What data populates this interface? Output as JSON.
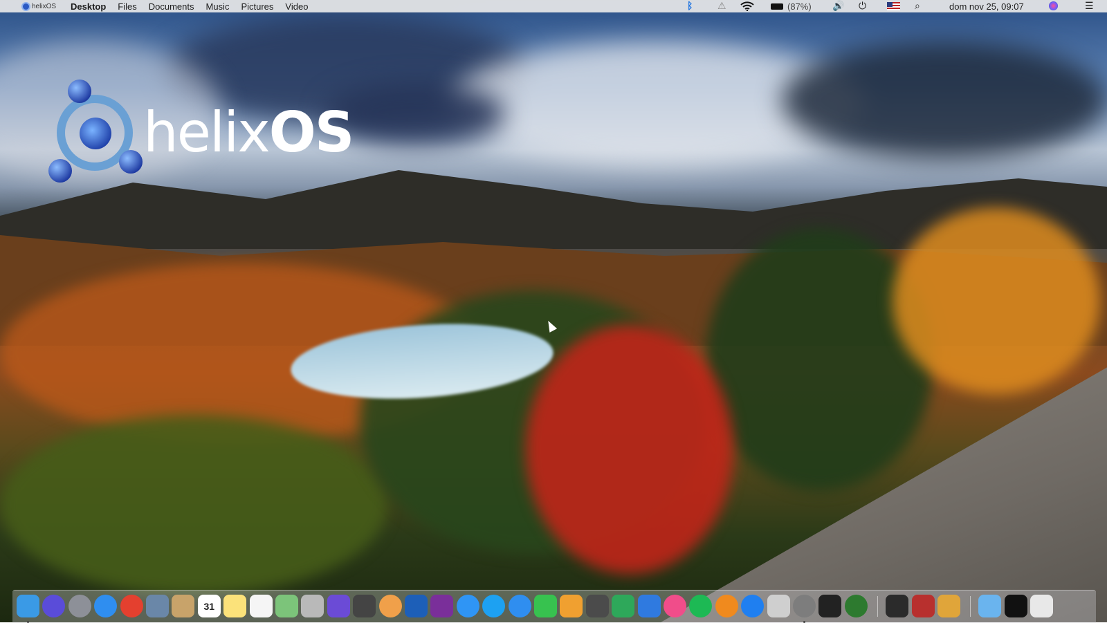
{
  "menubar": {
    "logo_text": "helixOS",
    "items": [
      "Desktop",
      "Files",
      "Documents",
      "Music",
      "Pictures",
      "Video"
    ],
    "battery": "(87%)",
    "clock": "dom nov 25, 09:07",
    "status_icons": [
      "bluetooth-icon",
      "warning-icon",
      "wifi-icon",
      "battery-icon",
      "speaker-icon",
      "power-icon",
      "flag-us-icon",
      "search-icon",
      "siri-icon",
      "menu-list-icon"
    ]
  },
  "desktop": {
    "logo": {
      "word_light": "helix",
      "word_bold": "OS"
    }
  },
  "dock": {
    "apps": [
      {
        "name": "finder-icon",
        "color": "#3a9ae6"
      },
      {
        "name": "siri-icon",
        "color": "#5a4cd9"
      },
      {
        "name": "launchpad-icon",
        "color": "#8d9098"
      },
      {
        "name": "safari-icon",
        "color": "#2f8ef0"
      },
      {
        "name": "chrome-icon",
        "color": "#e4402f"
      },
      {
        "name": "preview-icon",
        "color": "#6a87a8"
      },
      {
        "name": "contacts-icon",
        "color": "#c8a36a"
      },
      {
        "name": "calendar-icon",
        "color": "#ffffff",
        "text": "31"
      },
      {
        "name": "notes-icon",
        "color": "#fbe27a"
      },
      {
        "name": "reminders-icon",
        "color": "#f5f5f5"
      },
      {
        "name": "maps-icon",
        "color": "#7cc47a"
      },
      {
        "name": "photo-booth-icon",
        "color": "#b9b9b9"
      },
      {
        "name": "imovie-icon",
        "color": "#6b4bd6"
      },
      {
        "name": "final-cut-icon",
        "color": "#444444"
      },
      {
        "name": "photos-icon",
        "color": "#f0a04a"
      },
      {
        "name": "affinity-designer-icon",
        "color": "#1d5fb8"
      },
      {
        "name": "affinity-photo-icon",
        "color": "#7a2f9a"
      },
      {
        "name": "messages-icon",
        "color": "#2f95f5"
      },
      {
        "name": "twitter-icon",
        "color": "#1da1f2"
      },
      {
        "name": "messenger-icon",
        "color": "#2f8ef0"
      },
      {
        "name": "facetime-icon",
        "color": "#37c24f"
      },
      {
        "name": "pages-icon",
        "color": "#f0a030"
      },
      {
        "name": "keynote-display-icon",
        "color": "#4b4b4b"
      },
      {
        "name": "numbers-icon",
        "color": "#2ea85a"
      },
      {
        "name": "keynote-icon",
        "color": "#2f7ae0"
      },
      {
        "name": "itunes-icon",
        "color": "#f04d8a"
      },
      {
        "name": "spotify-icon",
        "color": "#1db954"
      },
      {
        "name": "books-icon",
        "color": "#f08a1e"
      },
      {
        "name": "app-store-icon",
        "color": "#1f7ff0"
      },
      {
        "name": "screenshot-icon",
        "color": "#cfcfcf"
      },
      {
        "name": "system-preferences-icon",
        "color": "#7d7d7d"
      },
      {
        "name": "terminal-icon",
        "color": "#222222"
      },
      {
        "name": "activity-monitor-icon",
        "color": "#2d7a2f"
      },
      {
        "name": "flashcut-icon",
        "color": "#2b2b2b"
      },
      {
        "name": "ink-icon",
        "color": "#b8302e"
      },
      {
        "name": "script-editor-icon",
        "color": "#e0a53a"
      },
      {
        "name": "downloads-folder-icon",
        "color": "#6ab4ee"
      },
      {
        "name": "documents-stack-icon",
        "color": "#111111"
      },
      {
        "name": "trash-icon",
        "color": "#e8e8e8"
      }
    ]
  }
}
